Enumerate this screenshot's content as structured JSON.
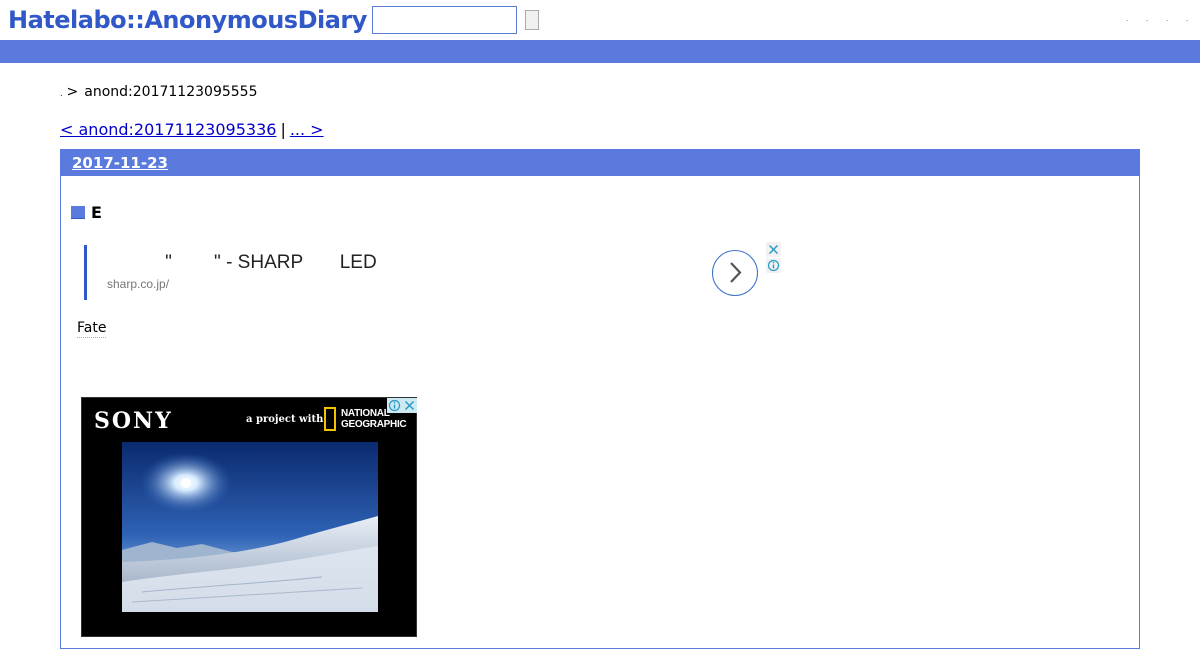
{
  "header": {
    "logo": "Hatelabo::AnonymousDiary",
    "search_value": "",
    "search_button_label": "",
    "links": [
      ".",
      ".",
      ".",
      "."
    ]
  },
  "breadcrumb": {
    "home": ".",
    "separator": ">",
    "current": "anond:20171123095555"
  },
  "pager": {
    "prev": "< anond:20171123095336",
    "separator": "|",
    "next": "... > "
  },
  "day": {
    "date": "2017-11-23",
    "section_title": "E",
    "body_text": "Fate"
  },
  "text_ad": {
    "headline": "           \"        \" - SHARP       LED",
    "url": "sharp.co.jp/"
  },
  "display_ad": {
    "brand": "SONY",
    "tagline": "a project with",
    "partner_line1": "NATIONAL",
    "partner_line2": "GEOGRAPHIC"
  },
  "colors": {
    "brand_blue": "#3158c8",
    "bar_blue": "#5a7bdd",
    "link": "#0000cc"
  },
  "icons": {
    "arrow": "chevron-right-icon",
    "close": "close-icon",
    "info": "info-icon"
  }
}
